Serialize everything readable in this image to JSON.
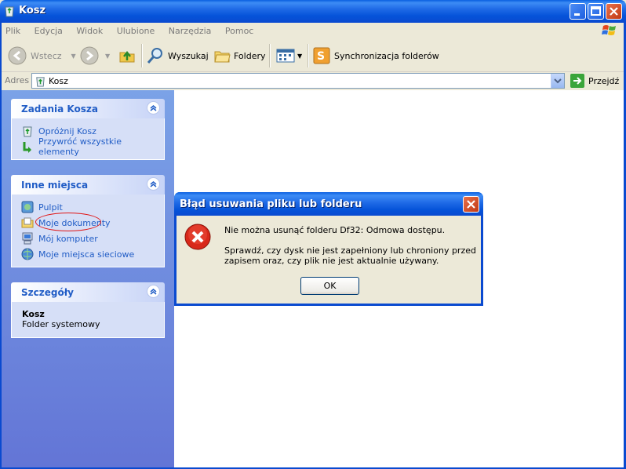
{
  "window": {
    "title": "Kosz"
  },
  "menu": {
    "items": [
      "Plik",
      "Edycja",
      "Widok",
      "Ulubione",
      "Narzędzia",
      "Pomoc"
    ]
  },
  "toolbar": {
    "back_label": "Wstecz",
    "search_label": "Wyszukaj",
    "folders_label": "Foldery",
    "sync_label": "Synchronizacja folderów"
  },
  "address": {
    "label": "Adres",
    "value": "Kosz",
    "go_label": "Przejdź"
  },
  "tasks": {
    "title": "Zadania Kosza",
    "items": [
      {
        "label": "Opróżnij Kosz",
        "icon": "empty-bin-icon"
      },
      {
        "label": "Przywróć wszystkie elementy",
        "icon": "restore-icon"
      }
    ]
  },
  "places": {
    "title": "Inne miejsca",
    "items": [
      {
        "label": "Pulpit",
        "icon": "desktop-icon"
      },
      {
        "label": "Moje dokumenty",
        "icon": "my-documents-icon"
      },
      {
        "label": "Mój komputer",
        "icon": "my-computer-icon"
      },
      {
        "label": "Moje miejsca sieciowe",
        "icon": "network-places-icon"
      }
    ]
  },
  "details": {
    "title": "Szczegóły",
    "name": "Kosz",
    "type": "Folder systemowy"
  },
  "dialog": {
    "title": "Błąd usuwania pliku lub folderu",
    "message1": "Nie można usunąć folderu Df32: Odmowa dostępu.",
    "message2": "Sprawdź, czy dysk nie jest zapełniony lub chroniony przed zapisem oraz, czy plik nie jest aktualnie używany.",
    "ok_label": "OK"
  },
  "colors": {
    "titlebar": "#0a4ad0",
    "link": "#215dc6",
    "pane": "#6375d6",
    "annotation": "#e01616"
  }
}
